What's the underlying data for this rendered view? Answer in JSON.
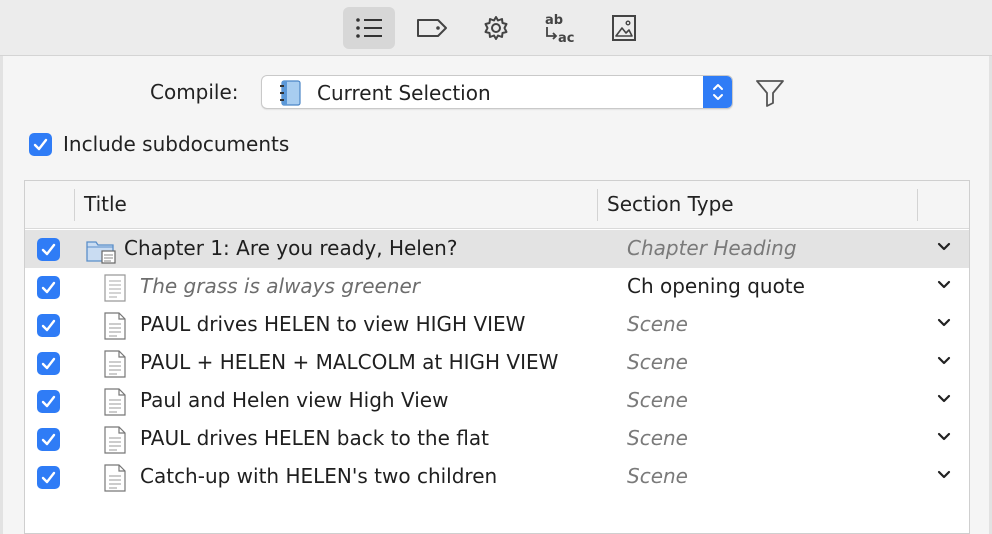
{
  "toolbar": {
    "icons": [
      "list-icon",
      "tag-icon",
      "gear-icon",
      "replacements-icon",
      "image-icon"
    ],
    "replacements_top": "ab",
    "replacements_bottom": "ac"
  },
  "compile": {
    "label": "Compile:",
    "selected": "Current Selection"
  },
  "include_subdocuments": {
    "label": "Include subdocuments",
    "checked": true
  },
  "table": {
    "headers": {
      "title": "Title",
      "section_type": "Section Type"
    },
    "rows": [
      {
        "title": "Chapter 1: Are you ready, Helen?",
        "section_type": "Chapter Heading",
        "checked": true,
        "kind": "folder",
        "selected": true
      },
      {
        "title": "The grass is always greener",
        "section_type": "Ch opening quote",
        "checked": true,
        "kind": "text"
      },
      {
        "title": "PAUL drives HELEN to view HIGH VIEW",
        "section_type": "Scene",
        "checked": true,
        "kind": "text"
      },
      {
        "title": "PAUL + HELEN + MALCOLM at HIGH VIEW",
        "section_type": "Scene",
        "checked": true,
        "kind": "text"
      },
      {
        "title": "Paul and Helen view High View",
        "section_type": "Scene",
        "checked": true,
        "kind": "text"
      },
      {
        "title": "PAUL drives HELEN back to the flat",
        "section_type": "Scene",
        "checked": true,
        "kind": "text"
      },
      {
        "title": "Catch-up with HELEN's two children",
        "section_type": "Scene",
        "checked": true,
        "kind": "text"
      }
    ]
  },
  "colors": {
    "accent": "#2f7cf6",
    "selected_row": "#e3e3e3"
  }
}
